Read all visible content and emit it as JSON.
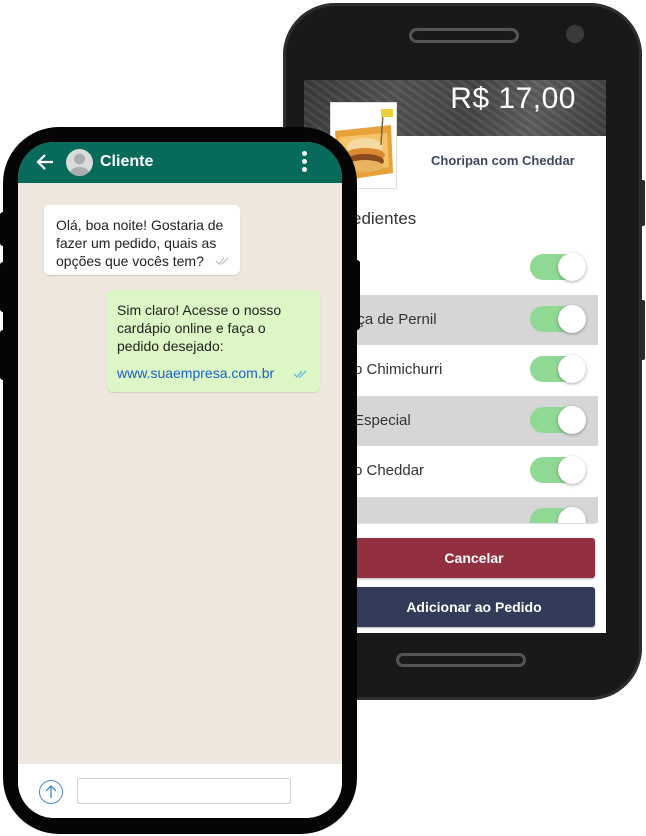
{
  "order_app": {
    "price": "R$ 17,00",
    "product_name": "Choripan com Cheddar",
    "section_title": "edientes",
    "options": [
      {
        "label": "",
        "enabled": true,
        "shaded": false
      },
      {
        "label": "iça de Pernil",
        "enabled": true,
        "shaded": true
      },
      {
        "label": "o Chimichurri",
        "enabled": true,
        "shaded": false
      },
      {
        "label": "Especial",
        "enabled": true,
        "shaded": true
      },
      {
        "label": "o Cheddar",
        "enabled": true,
        "shaded": false
      },
      {
        "label": "",
        "enabled": true,
        "shaded": true
      }
    ],
    "cancel_label": "Cancelar",
    "add_label": "Adicionar ao Pedido"
  },
  "chat": {
    "contact_name": "Cliente",
    "messages": [
      {
        "direction": "in",
        "lines": [
          "Olá, boa noite! Gostaria de",
          "fazer um pedido, quais as",
          "opções que vocês tem?"
        ]
      },
      {
        "direction": "out",
        "lines": [
          "Sim claro! Acesse o nosso",
          "cardápio online e faça o",
          "pedido desejado:"
        ],
        "link": "www.suaempresa.com.br"
      }
    ],
    "input_placeholder": ""
  },
  "colors": {
    "whatsapp_header": "#086a5a",
    "chat_background": "#ede7de",
    "outgoing_bubble": "#dcf7c5",
    "toggle_on": "#8fd994",
    "cancel_button": "#92303f",
    "add_button": "#323c58"
  },
  "icons": {
    "back": "arrow-left-icon",
    "avatar": "user-avatar-icon",
    "menu": "more-vertical-icon",
    "send": "arrow-up-circle-icon",
    "read_receipt": "double-check-icon"
  }
}
